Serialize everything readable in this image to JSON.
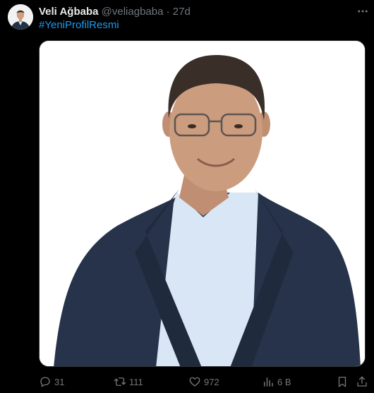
{
  "tweet": {
    "author_name": "Veli Ağbaba",
    "author_handle": "@veliagbaba",
    "separator": "·",
    "timestamp": "27d",
    "hashtag": "#YeniProfilResmi"
  },
  "actions": {
    "replies": "31",
    "retweets": "111",
    "likes": "972",
    "views": "6 B"
  },
  "icons": {
    "more": "more-horizontal-icon",
    "reply": "reply-icon",
    "retweet": "retweet-icon",
    "like": "heart-icon",
    "views": "views-chart-icon",
    "bookmark": "bookmark-icon",
    "share": "share-icon"
  },
  "colors": {
    "background": "#000000",
    "text": "#e7e9ea",
    "muted": "#71767b",
    "link": "#1d9bf0"
  }
}
